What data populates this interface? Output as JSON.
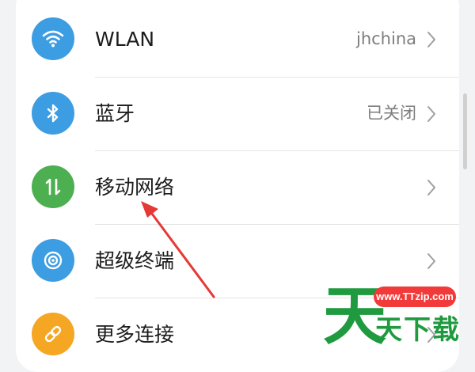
{
  "settings": {
    "rows": [
      {
        "label": "WLAN",
        "value": "jhchina",
        "icon": "wifi-icon",
        "color": "#3d9de2"
      },
      {
        "label": "蓝牙",
        "value": "已关闭",
        "icon": "bluetooth-icon",
        "color": "#3d9de2"
      },
      {
        "label": "移动网络",
        "value": "",
        "icon": "mobile-data-icon",
        "color": "#4caf50"
      },
      {
        "label": "超级终端",
        "value": "",
        "icon": "super-device-icon",
        "color": "#3d9de2"
      },
      {
        "label": "更多连接",
        "value": "",
        "icon": "link-icon",
        "color": "#f5a623"
      }
    ]
  },
  "watermark": {
    "url": "www.TTzip.com",
    "main": "天",
    "sub": "天下载"
  },
  "colors": {
    "arrow": "#e53935",
    "watermark_green": "#1f9a3f",
    "watermark_red": "#f23a3a"
  }
}
